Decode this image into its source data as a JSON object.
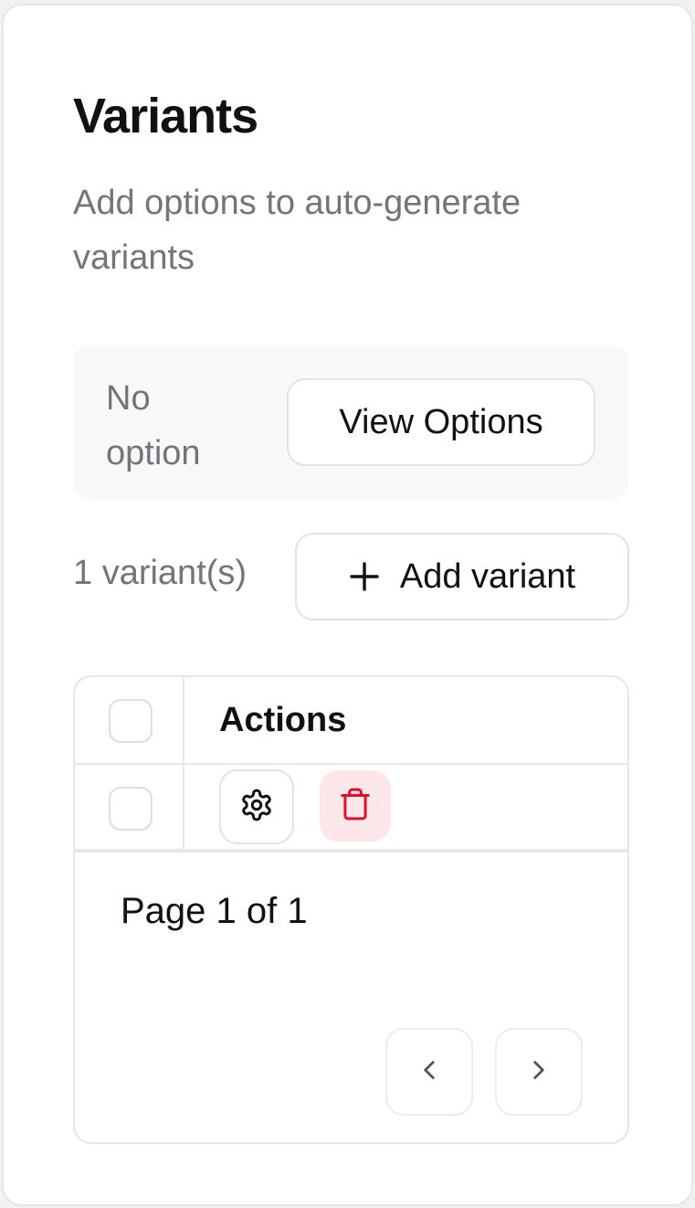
{
  "header": {
    "title": "Variants",
    "subtitle": "Add options to auto-generate variants"
  },
  "options": {
    "empty_text": "No option",
    "view_button_label": "View Options"
  },
  "variants": {
    "count_text": "1 variant(s)",
    "add_button_label": "Add variant"
  },
  "table": {
    "columns": [
      "Actions"
    ],
    "rows": [
      {
        "actions": [
          "settings",
          "delete"
        ]
      }
    ]
  },
  "pagination": {
    "page_text": "Page 1 of 1"
  },
  "icons": {
    "add": "plus-icon",
    "settings": "gear-icon",
    "delete": "trash-icon",
    "prev": "chevron-left-icon",
    "next": "chevron-right-icon"
  },
  "colors": {
    "danger": "#e0102a",
    "danger_bg": "#fde7ea",
    "muted_text": "#74747b"
  }
}
